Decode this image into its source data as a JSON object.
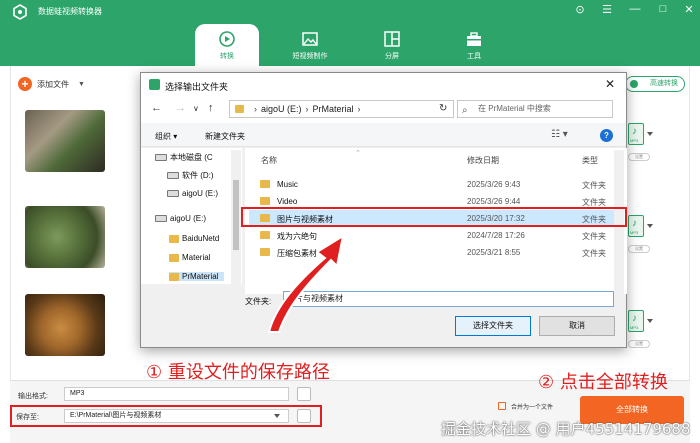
{
  "app": {
    "title": "数据蛙视频转换器",
    "tabs": [
      {
        "label": "转换",
        "icon": "convert-icon",
        "active": true
      },
      {
        "label": "短视频制作",
        "icon": "image-icon",
        "active": false
      },
      {
        "label": "分屏",
        "icon": "split-screen-icon",
        "active": false
      },
      {
        "label": "工具",
        "icon": "toolbox-icon",
        "active": false
      }
    ],
    "accent": "#2ca46a",
    "orange": "#f26522"
  },
  "toolbar": {
    "add_file": "添加文件",
    "hw_convert": "高速转换"
  },
  "items": [
    {
      "format": "MP3",
      "settings": "设置"
    },
    {
      "format": "MP3",
      "settings": "设置"
    },
    {
      "format": "MP3",
      "settings": "设置"
    }
  ],
  "bottom": {
    "output_format_label": "输出格式:",
    "output_format_value": "MP3",
    "save_to_label": "保存至:",
    "save_to_value": "E:\\PrMaterial\\图片与视频素材",
    "merge_label": "合并为一个文件",
    "convert_all": "全部转换"
  },
  "dialog": {
    "title": "选择输出文件夹",
    "address": [
      "aigoU (E:)",
      "PrMaterial"
    ],
    "search_placeholder": "在 PrMaterial 中搜索",
    "organize": "组织 ▾",
    "new_folder": "新建文件夹",
    "tree": [
      {
        "label": "本地磁盘 (C",
        "kind": "drive"
      },
      {
        "label": "软件 (D:)",
        "kind": "drive"
      },
      {
        "label": "aigoU (E:)",
        "kind": "drive"
      },
      {
        "label": "aigoU (E:)",
        "kind": "drive"
      },
      {
        "label": "BaiduNetd",
        "kind": "folder"
      },
      {
        "label": "Material",
        "kind": "folder"
      },
      {
        "label": "PrMaterial",
        "kind": "folder",
        "selected": true
      }
    ],
    "columns": {
      "name": "名称",
      "date": "修改日期",
      "type": "类型"
    },
    "files": [
      {
        "name": "Music",
        "date": "2025/3/26 9:43",
        "type": "文件夹"
      },
      {
        "name": "Video",
        "date": "2025/3/26 9:44",
        "type": "文件夹"
      },
      {
        "name": "图片与视频素材",
        "date": "2025/3/20 17:32",
        "type": "文件夹",
        "selected": true
      },
      {
        "name": "戏为六绝句",
        "date": "2024/7/28 17:26",
        "type": "文件夹"
      },
      {
        "name": "压缩包素材",
        "date": "2025/3/21 8:55",
        "type": "文件夹"
      }
    ],
    "folder_label": "文件夹:",
    "folder_value": "图片与视频素材",
    "select_button": "选择文件夹",
    "cancel_button": "取消"
  },
  "annotations": {
    "step1": "① 重设文件的保存路径",
    "step2": "② 点击全部转换",
    "watermark": "掘金技术社区 @ 用户45514179688"
  }
}
